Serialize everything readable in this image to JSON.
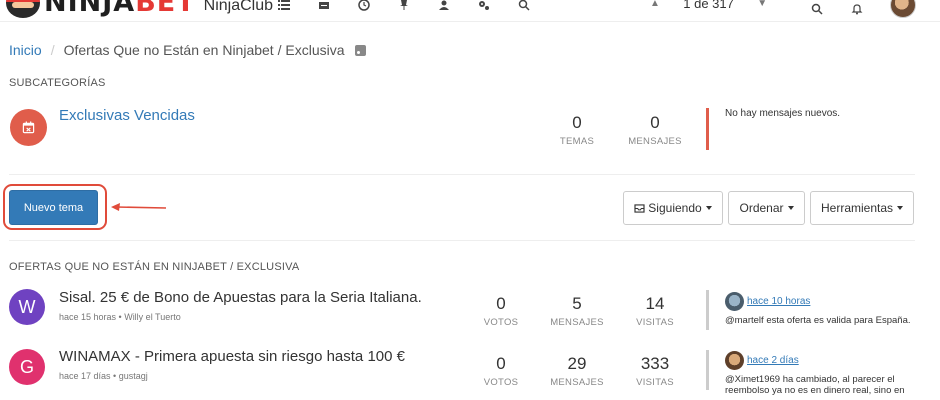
{
  "brand": {
    "name_ninja": "NINJA",
    "name_bet": "BET",
    "club": "NinjaClub"
  },
  "nav_icons": [
    "list-icon",
    "inbox-icon",
    "clock-icon",
    "pin-icon",
    "user-icon",
    "cogs-icon",
    "search-icon"
  ],
  "pager": {
    "text": "1 de 317"
  },
  "breadcrumb": {
    "home": "Inicio",
    "sep": "/",
    "current": "Ofertas Que no Están en Ninjabet / Exclusiva"
  },
  "subcategories": {
    "label": "SUBCATEGORÍAS",
    "items": [
      {
        "title": "Exclusivas Vencidas",
        "icon_color": "#e05d4b",
        "topics": "0",
        "topics_label": "TEMAS",
        "posts": "0",
        "posts_label": "MENSAJES",
        "last": "No hay mensajes nuevos."
      }
    ]
  },
  "toolbar": {
    "new_topic": "Nuevo tema",
    "following": "Siguiendo",
    "sort": "Ordenar",
    "tools": "Herramientas"
  },
  "topics_section": {
    "label": "OFERTAS QUE NO ESTÁN EN NINJABET / EXCLUSIVA",
    "votes_label": "VOTOS",
    "posts_label": "MENSAJES",
    "views_label": "VISITAS",
    "items": [
      {
        "avatar_letter": "W",
        "avatar_color": "#6f42c1",
        "title": "Sisal. 25 € de Bono de Apuestas para la Seria Italiana.",
        "meta": "hace 15 horas • Willy el Tuerto",
        "votes": "0",
        "posts": "5",
        "views": "14",
        "teaser_time": "hace 10 horas",
        "teaser_text": "@martelf esta oferta es valida para España."
      },
      {
        "avatar_letter": "G",
        "avatar_color": "#e0316e",
        "title": "WINAMAX - Primera apuesta sin riesgo hasta 100 €",
        "meta": "hace 17 días • gustagj",
        "votes": "0",
        "posts": "29",
        "views": "333",
        "teaser_time": "hace 2 días",
        "teaser_text": "@Ximet1969 ha cambiado, al parecer el reembolso ya no es en dinero real, sino en"
      }
    ]
  }
}
